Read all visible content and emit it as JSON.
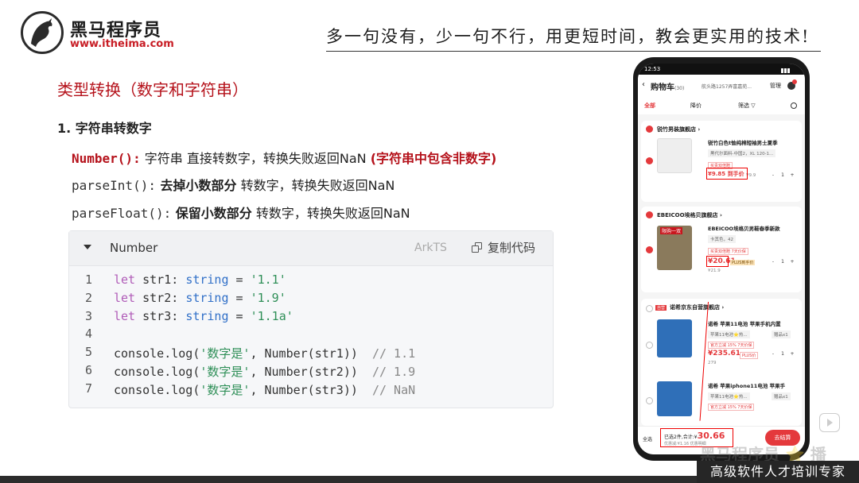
{
  "header": {
    "logo_text": "黑马程序员",
    "logo_url": "www.itheima.com",
    "slogan": "多一句没有，少一句不行，用更短时间，教会更实用的技术!"
  },
  "content": {
    "section_title": "类型转换（数字和字符串）",
    "item1": "1. 字符串转数字",
    "lines": [
      {
        "code": "Number():",
        "text1": " 字符串 直接转数字，转换失败返回NaN ",
        "highlight": "(字符串中包含非数字)"
      },
      {
        "code": "parseInt():",
        "bold": " 去掉小数部分",
        "text1": " 转数字，转换失败返回NaN"
      },
      {
        "code": "parseFloat():",
        "bold": " 保留小数部分",
        "text1": " 转数字，转换失败返回NaN"
      }
    ]
  },
  "codeblock": {
    "title": "Number",
    "language": "ArkTS",
    "copy_label": "复制代码",
    "lines": [
      {
        "n": "1",
        "kw": "let ",
        "v": "str1: ",
        "tp": "string",
        "eq": " = ",
        "s": "'1.1'"
      },
      {
        "n": "2",
        "kw": "let ",
        "v": "str2: ",
        "tp": "string",
        "eq": " = ",
        "s": "'1.9'"
      },
      {
        "n": "3",
        "kw": "let ",
        "v": "str3: ",
        "tp": "string",
        "eq": " = ",
        "s": "'1.1a'"
      },
      {
        "n": "4"
      },
      {
        "n": "5",
        "pre": "console.log(",
        "s": "'数字是'",
        "post": ", Number(str1))  ",
        "cm": "// 1.1"
      },
      {
        "n": "6",
        "pre": "console.log(",
        "s": "'数字是'",
        "post": ", Number(str2))  ",
        "cm": "// 1.9"
      },
      {
        "n": "7",
        "pre": "console.log(",
        "s": "'数字是'",
        "post": ", Number(str3))  ",
        "cm": "// NaN"
      }
    ]
  },
  "phone": {
    "time": "12:53",
    "cart_title": "购物车",
    "cart_count": "(30)",
    "address": "航头路1257弄富嘉苑...",
    "manage": "管理",
    "tabs": {
      "all": "全部",
      "drop": "降价",
      "filter": "筛选 ▽"
    },
    "stores": [
      {
        "name": "锐竹男装旗舰店 ›",
        "products": [
          {
            "name": "锐竹白色t恤纯棉短袖男士夏季",
            "spec": "黑代尔面料-中国2，XL 120-1...",
            "tag": "买贵双倍赔",
            "price": "¥9.85 到手价",
            "old": "¥9.9"
          }
        ]
      },
      {
        "name": "EBEICOO埃格贝旗舰店 ›",
        "products": [
          {
            "name": "EBEICOO埃格贝男鞋春季新款",
            "spec": "卡其色，42",
            "tag": "买贵双倍赔  7天价保",
            "price": "¥20.61",
            "plus": "PLUS到手价",
            "old": "¥21.9",
            "img_label": "限购一双"
          }
        ]
      },
      {
        "name": "诺希京东自营旗舰店 ›",
        "badge": "自营",
        "products": [
          {
            "name": "诺希 苹果11电池 苹果手机内置",
            "spec": "苹果11电池⭐热...",
            "spec2": "赠品x1",
            "tag": "官方立减 15%  7天价保",
            "price": "¥235.61",
            "plus": "PLUS价",
            "old": "279"
          },
          {
            "name": "诺希 苹果iphone11电池 苹果手",
            "spec": "苹果11电池⭐热...",
            "spec2": "赠品x1",
            "tag": "官方立减 15%  7天价保"
          }
        ]
      }
    ],
    "stepper": {
      "minus": "-",
      "qty": "1",
      "plus": "+"
    },
    "bottom": {
      "select_all": "全选",
      "total_label": "已选2件,合计:¥",
      "total_value": "30.66",
      "discount": "优惠减:¥1.16  优惠明细",
      "checkout": "去结算"
    }
  },
  "footer": {
    "tagline": "高级软件人才培训专家",
    "watermark": "黑马程序员 ⭐ 播"
  }
}
